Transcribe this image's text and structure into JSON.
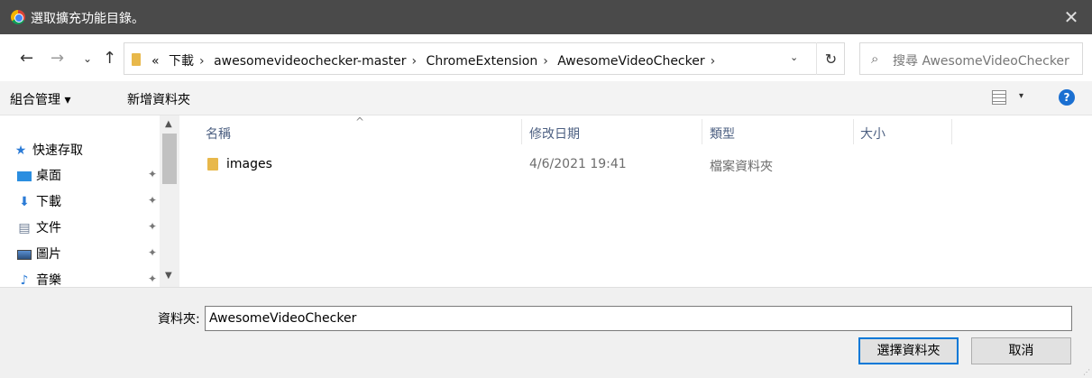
{
  "window": {
    "title": "選取擴充功能目錄。",
    "close_glyph": "✕"
  },
  "nav": {
    "back": "←",
    "forward": "→",
    "recent": "⌄",
    "up": "↑",
    "breadcrumb": [
      "«",
      "下載",
      "awesomevideochecker-master",
      "ChromeExtension",
      "AwesomeVideoChecker"
    ],
    "breadcrumb_sep": "›",
    "dropdown": "⌄",
    "refresh": "↻",
    "search_placeholder": "搜尋 AwesomeVideoChecker"
  },
  "toolbar": {
    "organize": "組合管理 ▾",
    "new_folder": "新增資料夾",
    "view_dropdown": "▾",
    "help": "?"
  },
  "sidebar": {
    "quick_access": "快速存取",
    "items": [
      {
        "label": "桌面",
        "icon": "desktop-icon"
      },
      {
        "label": "下載",
        "icon": "download-icon"
      },
      {
        "label": "文件",
        "icon": "document-icon"
      },
      {
        "label": "圖片",
        "icon": "pictures-icon"
      },
      {
        "label": "音樂",
        "icon": "music-icon"
      }
    ],
    "pin_glyph": "✦"
  },
  "columns": {
    "name": "名稱",
    "modified": "修改日期",
    "type": "類型",
    "size": "大小",
    "sort_caret": "^"
  },
  "files": [
    {
      "name": "images",
      "modified": "4/6/2021 19:41",
      "type": "檔案資料夾",
      "size": ""
    }
  ],
  "footer": {
    "folder_label": "資料夾:",
    "folder_value": "AwesomeVideoChecker",
    "select_button": "選擇資料夾",
    "cancel_button": "取消"
  },
  "colors": {
    "titlebar": "#4a4a4a",
    "accent": "#0078d7",
    "folder": "#e8b84a"
  }
}
